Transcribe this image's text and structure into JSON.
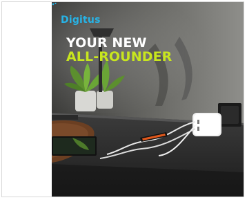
{
  "banner": {
    "logo_text": "Digitus",
    "headline_line1": "YOUR NEW",
    "headline_line2": "ALL-ROUNDER",
    "colors": {
      "logo": "#27b3e6",
      "headline_white": "#ffffff",
      "headline_accent": "#c8e61e"
    }
  }
}
